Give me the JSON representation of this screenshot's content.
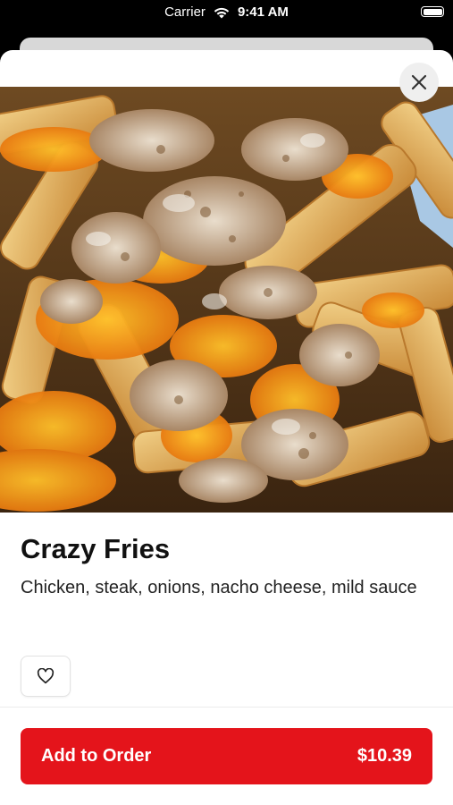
{
  "status_bar": {
    "carrier": "Carrier",
    "time": "9:41 AM"
  },
  "item": {
    "name": "Crazy Fries",
    "description": "Chicken, steak, onions, nacho cheese, mild sauce",
    "image_icon": "loaded-fries-photo"
  },
  "actions": {
    "close_icon": "close-icon",
    "favorite_icon": "heart-icon",
    "add_label": "Add to Order",
    "price": "$10.39"
  },
  "colors": {
    "accent": "#e4141b",
    "cheese": "#f6a21a",
    "fries": "#e3b265"
  }
}
